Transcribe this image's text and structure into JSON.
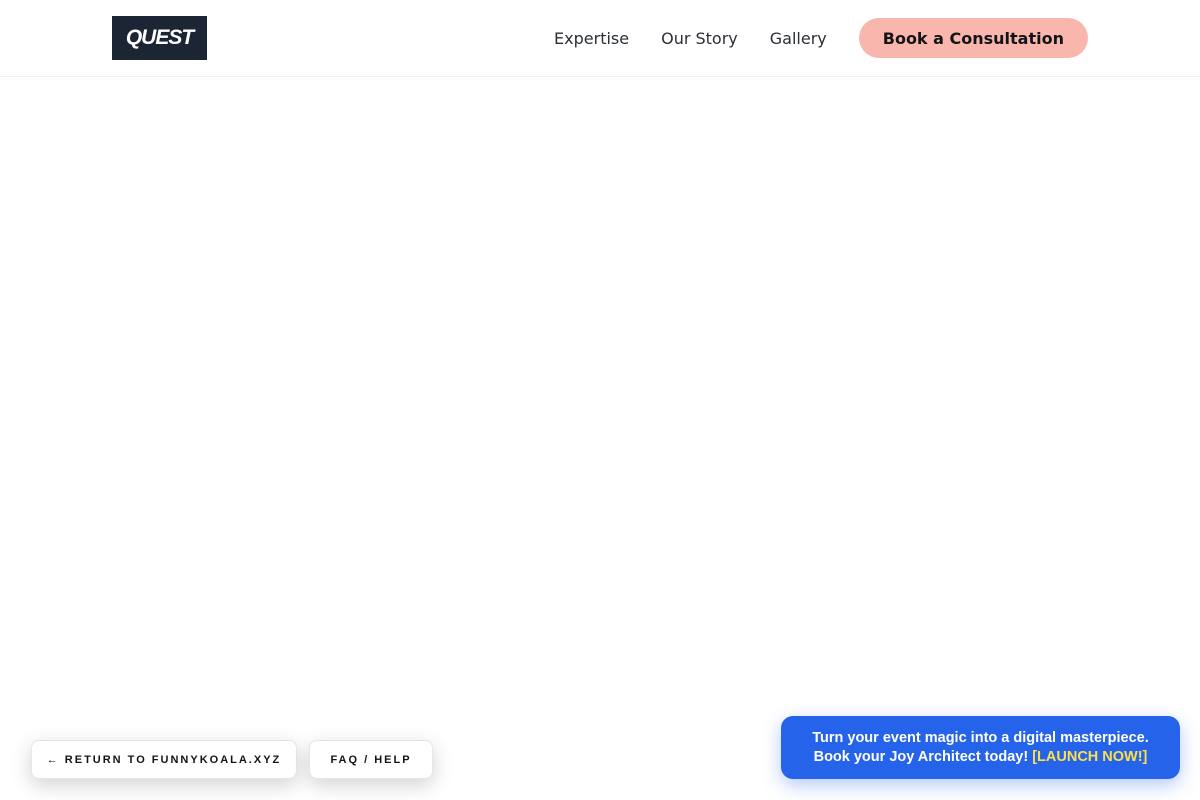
{
  "header": {
    "logo_text": "QUEST",
    "nav": [
      {
        "label": "Expertise"
      },
      {
        "label": "Our Story"
      },
      {
        "label": "Gallery"
      }
    ],
    "cta_label": "Book a Consultation"
  },
  "footer_links": {
    "return_label": "← RETURN TO FUNNYKOALA.XYZ",
    "faq_label": "FAQ / HELP"
  },
  "promo": {
    "line1": "Turn your event magic into a digital masterpiece.",
    "line2": "Book your Joy Architect today!",
    "launch": "[LAUNCH NOW!]"
  },
  "colors": {
    "logo_bg": "#1c2533",
    "cta_bg": "#f9b6ad",
    "promo_bg": "#2563eb",
    "promo_accent": "#fde047"
  }
}
